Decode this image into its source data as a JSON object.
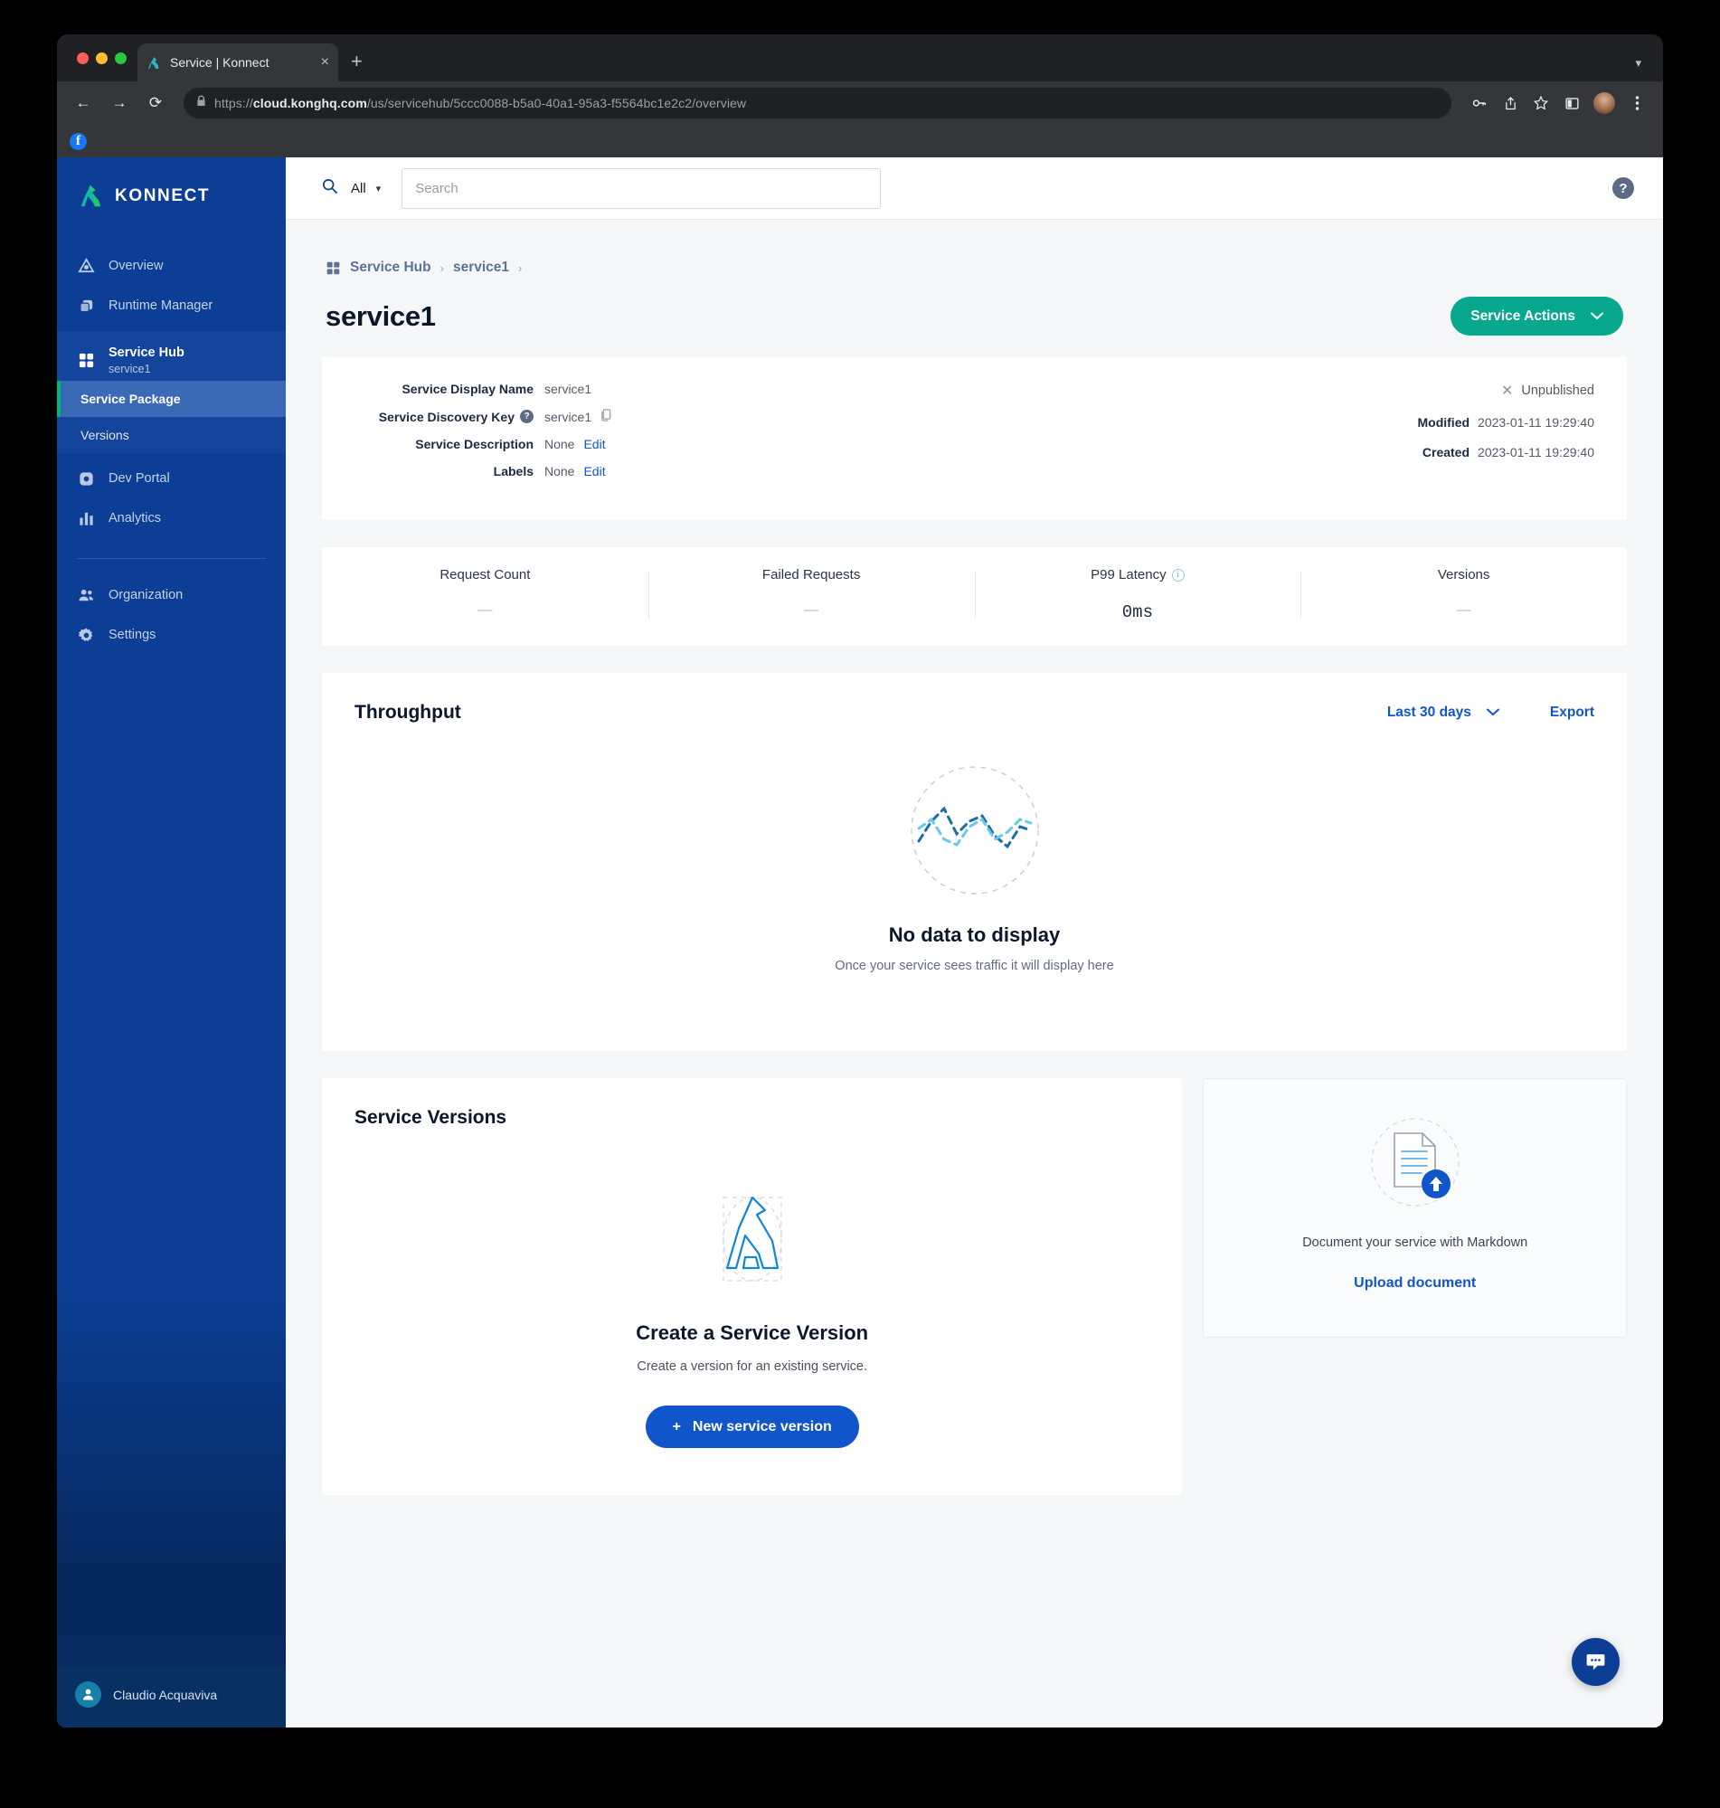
{
  "browser": {
    "tab_title": "Service | Konnect",
    "tab_favicon": "kong-icon",
    "new_tab_label": "+",
    "close_tab_label": "×",
    "url_scheme": "https://",
    "url_host": "cloud.konghq.com",
    "url_path": "/us/servicehub/5ccc0088-b5a0-40a1-95a3-f5564bc1e2c2/overview",
    "back_glyph": "←",
    "forward_glyph": "→",
    "reload_glyph": "⟳",
    "lock_glyph": "🔒",
    "bookmark_facebook": "f"
  },
  "sidebar": {
    "brand": "KONNECT",
    "items": [
      {
        "label": "Overview",
        "icon": "triangle-overview-icon"
      },
      {
        "label": "Runtime Manager",
        "icon": "layers-icon"
      }
    ],
    "service_hub": {
      "label": "Service Hub",
      "sub_label": "service1",
      "icon": "grid-icon",
      "children": [
        {
          "label": "Service Package",
          "selected": true
        },
        {
          "label": "Versions",
          "selected": false
        }
      ]
    },
    "items_after": [
      {
        "label": "Dev Portal",
        "icon": "portal-icon"
      },
      {
        "label": "Analytics",
        "icon": "bar-chart-icon"
      }
    ],
    "items_bottom": [
      {
        "label": "Organization",
        "icon": "people-icon"
      },
      {
        "label": "Settings",
        "icon": "gear-icon"
      }
    ],
    "user": {
      "name": "Claudio Acquaviva",
      "avatar_icon": "person-icon"
    }
  },
  "topbar": {
    "search_icon": "search-icon",
    "scope_label": "All",
    "scope_chevron": "⌄",
    "search_placeholder": "Search",
    "search_value": "",
    "help_icon": "help-icon",
    "help_glyph": "?"
  },
  "breadcrumb": {
    "icon": "grid-icon",
    "items": [
      "Service Hub",
      "service1"
    ],
    "separator": "›"
  },
  "page": {
    "title": "service1",
    "service_actions_label": "Service Actions",
    "service_actions_chevron": "⌄"
  },
  "info": {
    "rows": [
      {
        "label": "Service Display Name",
        "value": "service1",
        "has_help": false,
        "has_copy": false,
        "edit": ""
      },
      {
        "label": "Service Discovery Key",
        "value": "service1",
        "has_help": true,
        "has_copy": true,
        "edit": ""
      },
      {
        "label": "Service Description",
        "value": "None",
        "has_help": false,
        "has_copy": false,
        "edit": "Edit"
      },
      {
        "label": "Labels",
        "value": "None",
        "has_help": false,
        "has_copy": false,
        "edit": "Edit"
      }
    ],
    "status": {
      "icon": "x-icon",
      "glyph": "✕",
      "text": "Unpublished"
    },
    "meta": [
      {
        "label": "Modified",
        "value": "2023-01-11 19:29:40"
      },
      {
        "label": "Created",
        "value": "2023-01-11 19:29:40"
      }
    ]
  },
  "metrics": [
    {
      "label": "Request Count",
      "value": "—",
      "info": false,
      "mono": false
    },
    {
      "label": "Failed Requests",
      "value": "—",
      "info": false,
      "mono": false
    },
    {
      "label": "P99 Latency",
      "value": "0ms",
      "info": true,
      "info_glyph": "i",
      "mono": true
    },
    {
      "label": "Versions",
      "value": "—",
      "info": false,
      "mono": false
    }
  ],
  "throughput": {
    "title": "Throughput",
    "range_label": "Last 30 days",
    "range_chevron": "⌄",
    "export_label": "Export",
    "empty_title": "No data to display",
    "empty_subtitle": "Once your service sees traffic it will display here",
    "empty_icon": "dashed-line-chart-icon"
  },
  "service_versions": {
    "card_title": "Service Versions",
    "empty_icon": "kong-outline-icon",
    "empty_title": "Create a Service Version",
    "empty_subtitle": "Create a version for an existing service.",
    "button_plus": "+",
    "button_label": "New service version"
  },
  "document_card": {
    "icon": "document-upload-icon",
    "text": "Document your service with Markdown",
    "link_label": "Upload document"
  },
  "chat": {
    "icon": "chat-bubble-icon"
  },
  "colors": {
    "sidebar_blue": "#0b3e94",
    "accent_green": "#07a88d",
    "link_blue": "#1155cb",
    "primary_blue": "#1155cb",
    "selected_nav": "#3a6ab5",
    "nav_accent_bar": "#00b67a"
  }
}
